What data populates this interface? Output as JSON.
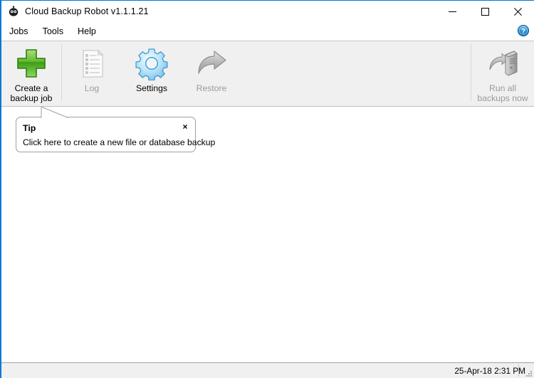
{
  "window": {
    "title": "Cloud Backup Robot v1.1.1.21",
    "app_icon": "robot-icon",
    "border_color": "#0078d7",
    "caption": {
      "minimize": "minimize-icon",
      "maximize": "maximize-icon",
      "close": "close-icon"
    }
  },
  "menubar": {
    "items": [
      {
        "label": "Jobs"
      },
      {
        "label": "Tools"
      },
      {
        "label": "Help"
      }
    ],
    "help_icon": "help-circle-icon"
  },
  "toolbar": {
    "buttons": [
      {
        "id": "create-backup-job",
        "label": "Create a\nbackup job",
        "icon": "green-plus-icon",
        "enabled": true
      },
      {
        "id": "log",
        "label": "Log",
        "icon": "document-list-icon",
        "enabled": false
      },
      {
        "id": "settings",
        "label": "Settings",
        "icon": "gear-icon",
        "enabled": true
      },
      {
        "id": "restore",
        "label": "Restore",
        "icon": "curved-arrow-icon",
        "enabled": false
      }
    ],
    "right_button": {
      "id": "run-all-backups-now",
      "label": "Run all\nbackups now",
      "icon": "server-tower-icon",
      "enabled": false
    }
  },
  "tip": {
    "title": "Tip",
    "message": "Click here to create a new file or database backup",
    "close_icon": "close-x-icon"
  },
  "statusbar": {
    "datetime": "25-Apr-18 2:31 PM",
    "grip": "resize-grip-icon"
  },
  "colors": {
    "accent": "#0078d7",
    "toolbar_bg": "#f0f0f0",
    "client_bg": "#ffffff",
    "disabled_text": "#9a9a9a",
    "plus_green": "#4fae27",
    "gear_blue": "#7fc4ec"
  }
}
